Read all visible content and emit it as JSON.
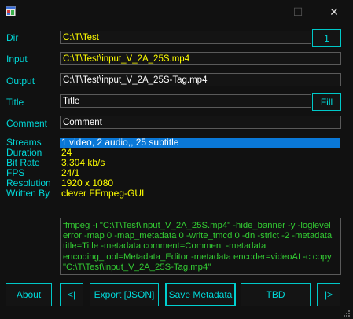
{
  "window": {
    "minimize": "—",
    "maximize": "☐",
    "close": "✕"
  },
  "form": {
    "dir": {
      "label": "Dir",
      "value": "C:\\T\\Test",
      "button": "1"
    },
    "input": {
      "label": "Input",
      "value": "C:\\T\\Test\\input_V_2A_25S.mp4"
    },
    "output": {
      "label": "Output",
      "value": "C:\\T\\Test\\input_V_2A_25S-Tag.mp4"
    },
    "title": {
      "label": "Title",
      "value": "Title",
      "button": "Fill"
    },
    "comment": {
      "label": "Comment",
      "value": "Comment"
    }
  },
  "info": {
    "streams": {
      "label": "Streams",
      "value": "1 video, 2 audio,, 25 subtitle"
    },
    "duration": {
      "label": "Duration",
      "value": "24"
    },
    "bitrate": {
      "label": "Bit Rate",
      "value": "3,304 kb/s"
    },
    "fps": {
      "label": "FPS",
      "value": "24/1"
    },
    "resolution": {
      "label": "Resolution",
      "value": "1920 x 1080"
    },
    "written_by": {
      "label": "Written By",
      "value": "clever FFmpeg-GUI"
    }
  },
  "command": "ffmpeg -i \"C:\\T\\Test\\input_V_2A_25S.mp4\" -hide_banner -y -loglevel error -map 0 -map_metadata 0 -write_tmcd 0 -dn -strict -2 -metadata title=Title -metadata comment=Comment  -metadata encoding_tool=Metadata_Editor -metadata encoder=videoAI -c copy \"C:\\T\\Test\\input_V_2A_25S-Tag.mp4\"",
  "buttons": {
    "about": "About",
    "prev": "<|",
    "export": "Export [JSON]",
    "save": "Save Metadata",
    "tbd": "TBD",
    "next": "|>"
  },
  "colors": {
    "accent": "#00d8d8",
    "value_text": "#ffff00",
    "highlight": "#0a78d7",
    "command_text": "#33cc33"
  }
}
